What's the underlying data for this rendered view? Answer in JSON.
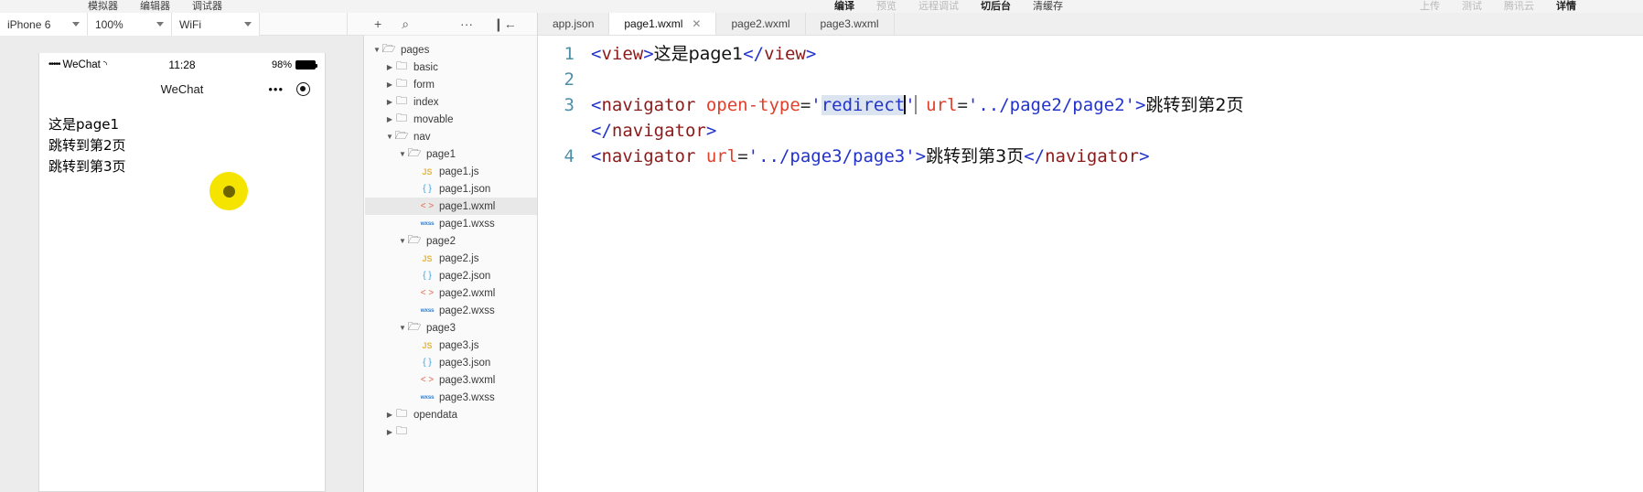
{
  "topbar": {
    "left_items": [
      {
        "label": "模拟器",
        "state": "normal"
      },
      {
        "label": "编辑器",
        "state": "normal"
      },
      {
        "label": "调试器",
        "state": "normal"
      }
    ],
    "center_items": [
      {
        "label": "编译",
        "state": "strong"
      },
      {
        "label": "预览",
        "state": "dim"
      },
      {
        "label": "远程调试",
        "state": "dim"
      },
      {
        "label": "切后台",
        "state": "strong"
      },
      {
        "label": "清缓存",
        "state": "normal"
      }
    ],
    "right_items": [
      {
        "label": "上传",
        "state": "dim"
      },
      {
        "label": "测试",
        "state": "dim"
      },
      {
        "label": "腾讯云",
        "state": "dim"
      },
      {
        "label": "详情",
        "state": "strong"
      }
    ]
  },
  "devbar": {
    "device": "iPhone 6",
    "zoom": "100%",
    "network": "WiFi"
  },
  "simulator": {
    "status": {
      "signal_dots": "•••••",
      "carrier": "WeChat",
      "wifi_icon": "wifi-icon",
      "time": "11:28",
      "battery_percent": "98%"
    },
    "nav": {
      "title": "WeChat",
      "capsule_more": "•••",
      "capsule_target": "target-icon"
    },
    "page_lines": [
      "这是page1",
      "跳转到第2页",
      "跳转到第3页"
    ],
    "float_ball": "debug-float-ball"
  },
  "tree": {
    "toolbar": [
      {
        "icon": "add-icon",
        "glyph": "+"
      },
      {
        "icon": "search-icon",
        "glyph": "⌕"
      },
      {
        "icon": "more-icon",
        "glyph": "···"
      },
      {
        "icon": "collapse-panel-icon",
        "glyph": "❙←"
      }
    ],
    "nodes": [
      {
        "depth": 0,
        "arrow": "▼",
        "type": "folder-open",
        "label": "pages",
        "selected": false
      },
      {
        "depth": 1,
        "arrow": "▶",
        "type": "folder",
        "label": "basic",
        "selected": false
      },
      {
        "depth": 1,
        "arrow": "▶",
        "type": "folder",
        "label": "form",
        "selected": false
      },
      {
        "depth": 1,
        "arrow": "▶",
        "type": "folder",
        "label": "index",
        "selected": false
      },
      {
        "depth": 1,
        "arrow": "▶",
        "type": "folder",
        "label": "movable",
        "selected": false
      },
      {
        "depth": 1,
        "arrow": "▼",
        "type": "folder-open",
        "label": "nav",
        "selected": false
      },
      {
        "depth": 2,
        "arrow": "▼",
        "type": "folder-open",
        "label": "page1",
        "selected": false
      },
      {
        "depth": 3,
        "arrow": "",
        "type": "js",
        "label": "page1.js",
        "selected": false
      },
      {
        "depth": 3,
        "arrow": "",
        "type": "json",
        "label": "page1.json",
        "selected": false
      },
      {
        "depth": 3,
        "arrow": "",
        "type": "wxml",
        "label": "page1.wxml",
        "selected": true
      },
      {
        "depth": 3,
        "arrow": "",
        "type": "wxss",
        "label": "page1.wxss",
        "selected": false
      },
      {
        "depth": 2,
        "arrow": "▼",
        "type": "folder-open",
        "label": "page2",
        "selected": false
      },
      {
        "depth": 3,
        "arrow": "",
        "type": "js",
        "label": "page2.js",
        "selected": false
      },
      {
        "depth": 3,
        "arrow": "",
        "type": "json",
        "label": "page2.json",
        "selected": false
      },
      {
        "depth": 3,
        "arrow": "",
        "type": "wxml",
        "label": "page2.wxml",
        "selected": false
      },
      {
        "depth": 3,
        "arrow": "",
        "type": "wxss",
        "label": "page2.wxss",
        "selected": false
      },
      {
        "depth": 2,
        "arrow": "▼",
        "type": "folder-open",
        "label": "page3",
        "selected": false
      },
      {
        "depth": 3,
        "arrow": "",
        "type": "js",
        "label": "page3.js",
        "selected": false
      },
      {
        "depth": 3,
        "arrow": "",
        "type": "json",
        "label": "page3.json",
        "selected": false
      },
      {
        "depth": 3,
        "arrow": "",
        "type": "wxml",
        "label": "page3.wxml",
        "selected": false
      },
      {
        "depth": 3,
        "arrow": "",
        "type": "wxss",
        "label": "page3.wxss",
        "selected": false
      },
      {
        "depth": 1,
        "arrow": "▶",
        "type": "folder",
        "label": "opendata",
        "selected": false
      },
      {
        "depth": 1,
        "arrow": "▶",
        "type": "folder",
        "label": "",
        "selected": false
      }
    ]
  },
  "editor": {
    "tabs": [
      {
        "label": "app.json",
        "active": false,
        "closable": false
      },
      {
        "label": "page1.wxml",
        "active": true,
        "closable": true,
        "close_glyph": "✕"
      },
      {
        "label": "page2.wxml",
        "active": false,
        "closable": false
      },
      {
        "label": "page3.wxml",
        "active": false,
        "closable": false
      }
    ],
    "lines": [
      {
        "num": "1",
        "text": "<view>这是page1</view>"
      },
      {
        "num": "2",
        "text": ""
      },
      {
        "num": "3",
        "text": "<navigator open-type='redirect' url='../page2/page2'>跳转到第2页</navigator>"
      },
      {
        "num": "4",
        "text": "<navigator url='../page3/page3'>跳转到第3页</navigator>"
      }
    ],
    "selection_text": "redirect"
  }
}
